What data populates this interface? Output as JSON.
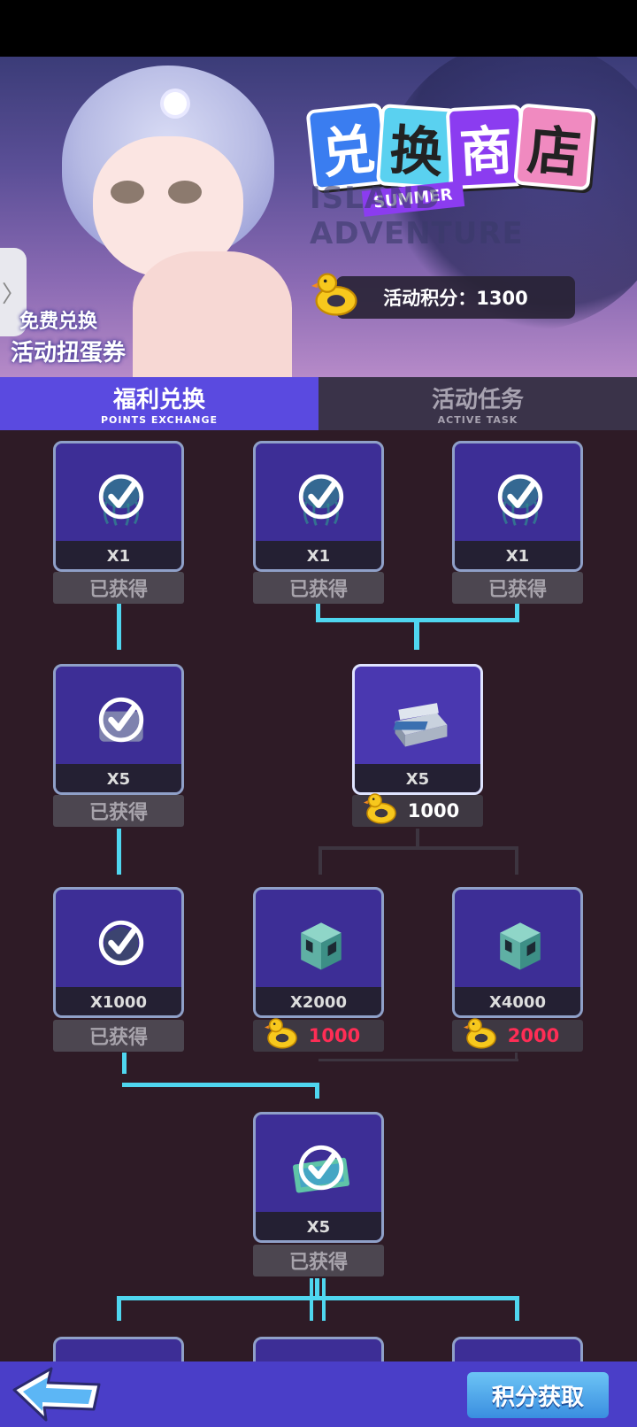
{
  "header": {
    "free_exchange": "免费兑换",
    "gacha_ticket": "活动扭蛋券",
    "shop_title_chars": [
      "兑",
      "换",
      "商",
      "店"
    ],
    "summer_tag": "SUMMER",
    "adventure_text": "ISLAND ADVENTURE",
    "points_label": "活动积分：1300"
  },
  "tabs": [
    {
      "label": "福利兑换",
      "sub": "POINTS EXCHANGE",
      "active": true
    },
    {
      "label": "活动任务",
      "sub": "ACTIVE TASK",
      "active": false
    }
  ],
  "rewards": {
    "r1a_qty": "X1",
    "r1a_status": "已获得",
    "r1b_qty": "X1",
    "r1b_status": "已获得",
    "r1c_qty": "X1",
    "r1c_status": "已获得",
    "r2a_qty": "X5",
    "r2a_status": "已获得",
    "r2b_qty": "X5",
    "r2b_price": "1000",
    "r3a_qty": "X1000",
    "r3a_status": "已获得",
    "r3b_qty": "X2000",
    "r3b_price": "1000",
    "r3c_qty": "X4000",
    "r3c_price": "2000",
    "r4_qty": "X5",
    "r4_status": "已获得"
  },
  "footer": {
    "earn_label": "积分获取"
  },
  "colors": {
    "accent_tab": "#5a4ae0",
    "connector": "#4fd6ef",
    "price_red": "#ff2d55",
    "card_bg": "#3d2e96"
  },
  "icons": [
    "check-icon",
    "jellyfish-icon",
    "chest-icon",
    "cube-icon",
    "ticket-icon",
    "duck-ring-icon",
    "back-arrow-icon"
  ]
}
